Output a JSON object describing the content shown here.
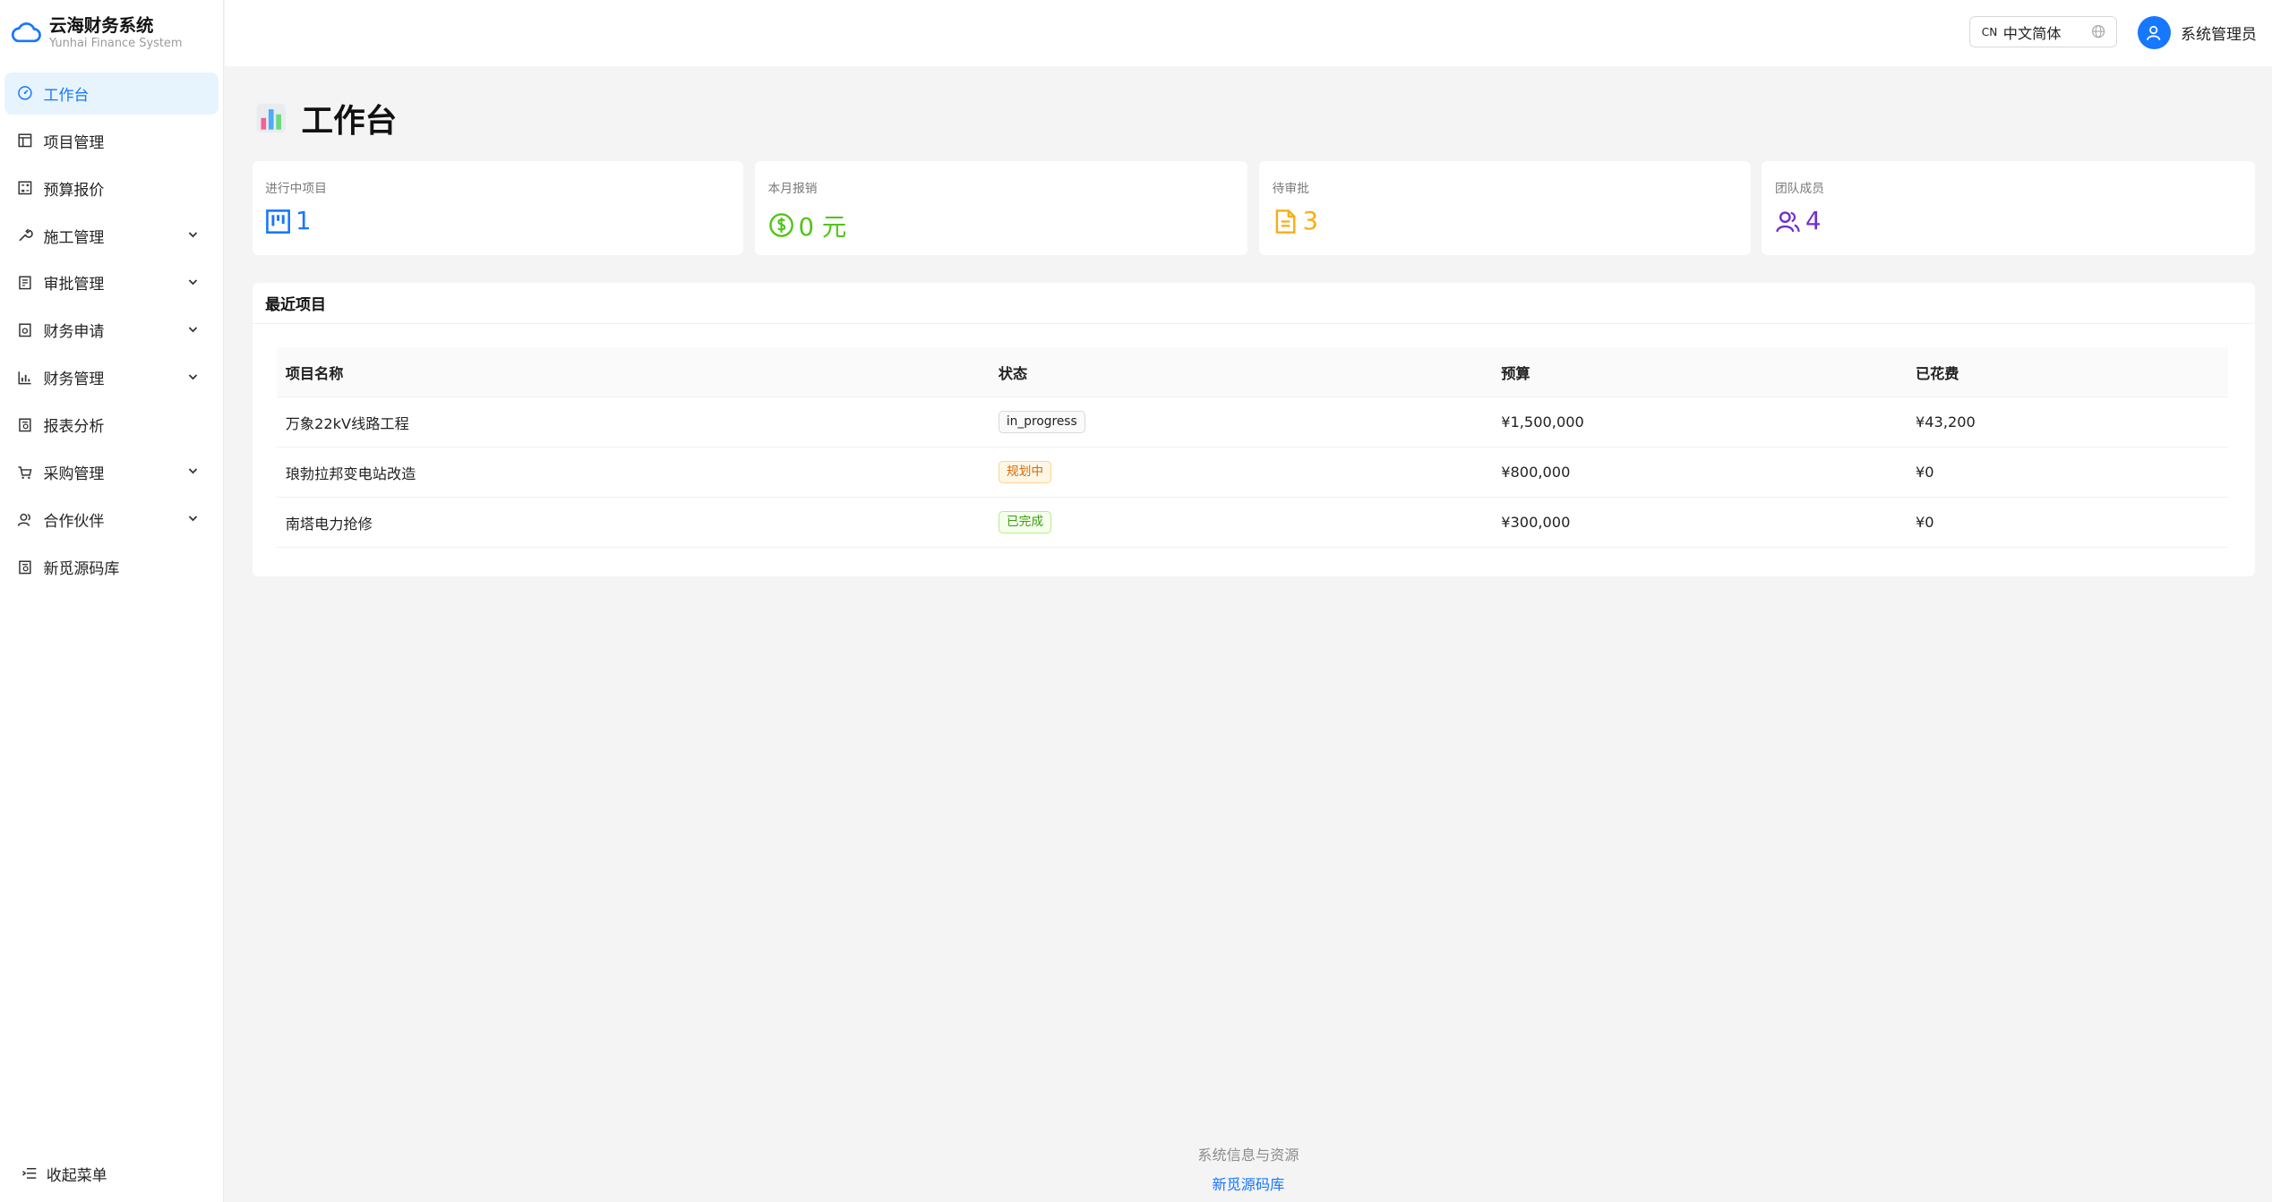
{
  "app": {
    "title": "云海财务系统",
    "subtitle": "Yunhai Finance System"
  },
  "sidebar": {
    "items": [
      {
        "label": "工作台",
        "icon": "dashboard-icon",
        "active": true,
        "expandable": false
      },
      {
        "label": "项目管理",
        "icon": "project-icon",
        "active": false,
        "expandable": false
      },
      {
        "label": "预算报价",
        "icon": "calculator-icon",
        "active": false,
        "expandable": false
      },
      {
        "label": "施工管理",
        "icon": "tool-icon",
        "active": false,
        "expandable": true
      },
      {
        "label": "审批管理",
        "icon": "audit-icon",
        "active": false,
        "expandable": true
      },
      {
        "label": "财务申请",
        "icon": "form-icon",
        "active": false,
        "expandable": true
      },
      {
        "label": "财务管理",
        "icon": "chart-icon",
        "active": false,
        "expandable": true
      },
      {
        "label": "报表分析",
        "icon": "report-icon",
        "active": false,
        "expandable": false
      },
      {
        "label": "采购管理",
        "icon": "cart-icon",
        "active": false,
        "expandable": true
      },
      {
        "label": "合作伙伴",
        "icon": "partner-icon",
        "active": false,
        "expandable": true
      },
      {
        "label": "新觅源码库",
        "icon": "repo-icon",
        "active": false,
        "expandable": false
      }
    ],
    "collapse_label": "收起菜单"
  },
  "header": {
    "language": {
      "flag": "CN",
      "label": "中文简体"
    },
    "user": {
      "name": "系统管理员"
    }
  },
  "page": {
    "title": "工作台"
  },
  "stats": [
    {
      "label": "进行中项目",
      "value": "1",
      "icon": "kanban-icon",
      "color": "#1677ff"
    },
    {
      "label": "本月报销",
      "value": "0 元",
      "icon": "dollar-circle-icon",
      "color": "#52c41a"
    },
    {
      "label": "待审批",
      "value": "3",
      "icon": "document-icon",
      "color": "#faad14"
    },
    {
      "label": "团队成员",
      "value": "4",
      "icon": "team-icon",
      "color": "#722ed1"
    }
  ],
  "recent_projects": {
    "title": "最近项目",
    "columns": [
      "项目名称",
      "状态",
      "预算",
      "已花费"
    ],
    "rows": [
      {
        "name": "万象22kV线路工程",
        "status": "in_progress",
        "status_style": "default",
        "budget": "¥1,500,000",
        "spent": "¥43,200"
      },
      {
        "name": "琅勃拉邦变电站改造",
        "status": "规划中",
        "status_style": "orange",
        "budget": "¥800,000",
        "spent": "¥0"
      },
      {
        "name": "南塔电力抢修",
        "status": "已完成",
        "status_style": "green",
        "budget": "¥300,000",
        "spent": "¥0"
      }
    ]
  },
  "footer": {
    "info": "系统信息与资源",
    "link": "新觅源码库"
  }
}
